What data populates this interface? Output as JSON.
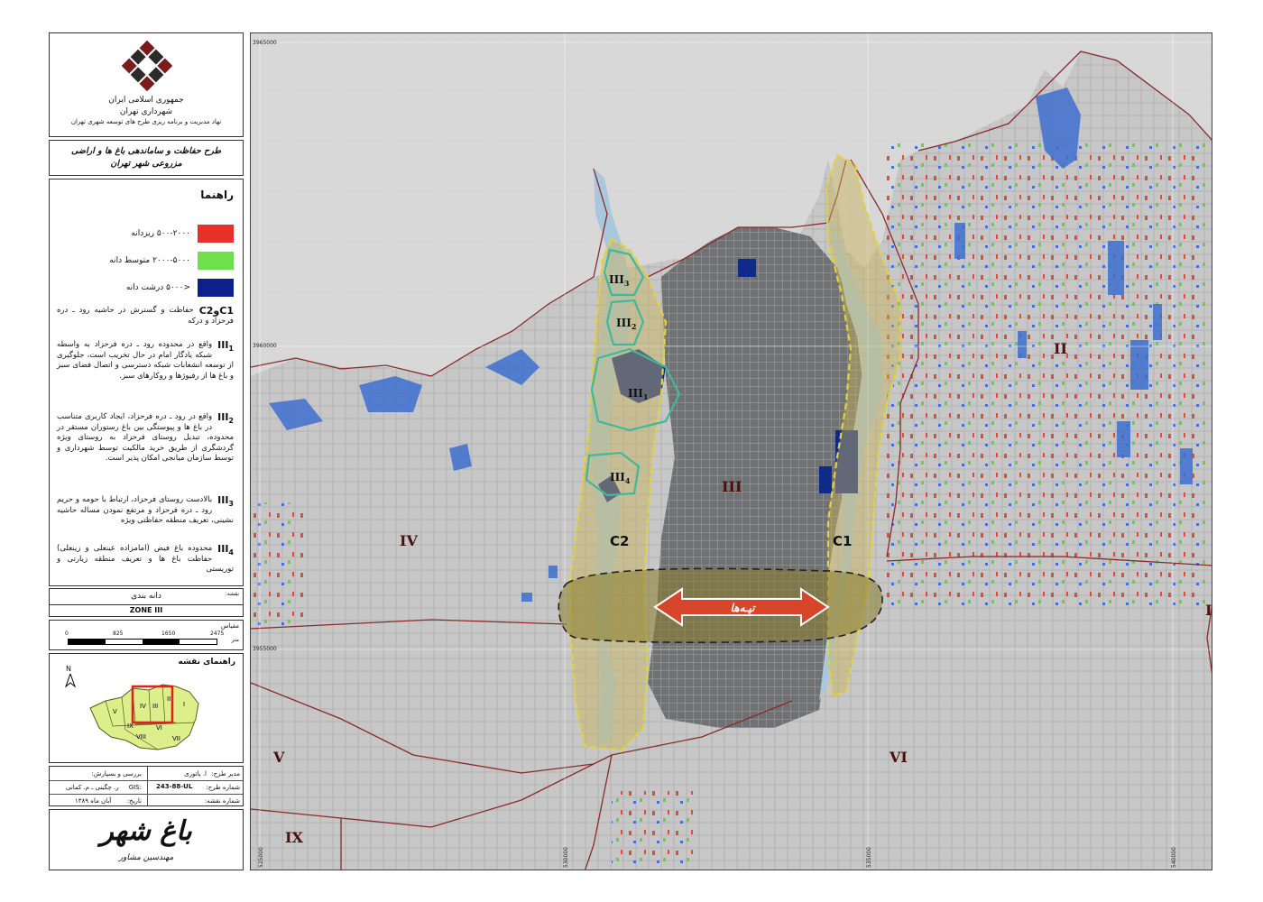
{
  "header": {
    "org_line1": "جمهوری اسلامی ایران",
    "org_line2": "شهرداری تهران",
    "org_line3": "نهاد مدیریت و برنامه ریزی طرح های توسعه شهری تهران"
  },
  "project_title": "طرح حفاظت و ساماندهی باغ ها و اراضی مزروعی شهر تهران",
  "legend": {
    "title": "راهنما",
    "items": [
      {
        "label": "۵۰۰-۲۰۰۰ ریزدانه",
        "color": "#e8302a"
      },
      {
        "label": "۲۰۰۰-۵۰۰۰ متوسط دانه",
        "color": "#6fe04a"
      },
      {
        "label": "<۵۰۰۰ درشت دانه",
        "color": "#0c1f8a"
      }
    ]
  },
  "descriptions": [
    {
      "code": "C1وC2",
      "text": "حفاظت و گسترش در حاشیه رود ـ دره فرحزاد و درکه"
    },
    {
      "code": "III",
      "sub": "1",
      "text": "واقع در محدوده رود ـ دره فرحزاد به واسطه شبکه یادگار امام در حال تخریب است، جلوگیری از توسعه انشعابات شبکه دسترسی و اتصال فضای سبز و باغ ها از رفیوژها و روکارهای سبز."
    },
    {
      "code": "III",
      "sub": "2",
      "text": "واقع در رود ـ دره فرحزاد، ایجاد کاربری متناسب در باغ ها و پیوستگی بین باغ رستوران مستقر در محدوده، تبدیل روستای فرحزاد به روستای ویژه گردشگری از طریق خرید مالکیت توسط شهرداری و توسط سازمان میانجی امکان پذیر است."
    },
    {
      "code": "III",
      "sub": "3",
      "text": "بالادست روستای فرحزاد، ارتباط با حومه و حریم رود ـ دره فرحزاد و مرتفع نمودن مساله حاشیه نشینی، تعریف منطقه حفاظتی ویژه"
    },
    {
      "code": "III",
      "sub": "4",
      "text": "محدوده باغ فیض (امامزاده عینعلی و زینعلی) حفاظت باغ ها و تعریف منطقه زیارتی و توریستی"
    }
  ],
  "map_info": {
    "caption_label": "نقشه:",
    "caption_value": "دانه بندی",
    "zone": "ZONE III"
  },
  "scale_bar": {
    "title": "مقیاس",
    "unit": "متر",
    "ticks": [
      "0",
      "825",
      "1650",
      "2475"
    ]
  },
  "guide_map": {
    "title": "راهنمای نقشه",
    "north": "N",
    "zones": [
      "I",
      "II",
      "III",
      "IV",
      "V",
      "VI",
      "VII",
      "VIII",
      "IX"
    ]
  },
  "info_table": {
    "row1_left_label": "بررسی و بسپارش:",
    "row1_right_label": "مدیر طرح:",
    "row1_right_value": "ا. پاتوری",
    "row2_left_label": "GIS:",
    "row2_left_value": "ر. چگینی ـ م. کمانی",
    "row2_right_label": "شماره طرح:",
    "row2_right_value": "243-88-UL",
    "row3_left_label": "تاریخ:",
    "row3_left_value": "آبان ماه ۱۳۸۹",
    "row3_right_label": "شماره نقشه:"
  },
  "footer": {
    "logo_text": "باغ شهر",
    "logo_sub": "مهندسین مشاور"
  },
  "map": {
    "zones": [
      "I",
      "II",
      "III",
      "IV",
      "V",
      "VI",
      "IX"
    ],
    "buffers": [
      "C1",
      "C2"
    ],
    "subzones": [
      {
        "main": "III",
        "sub": "1"
      },
      {
        "main": "III",
        "sub": "2"
      },
      {
        "main": "III",
        "sub": "3"
      },
      {
        "main": "III",
        "sub": "4"
      }
    ],
    "hills_label": "تپـه‌ها",
    "coords_top": [
      "3965000",
      "3960000",
      "3955000"
    ],
    "coords_bottom": [
      "525000",
      "530000",
      "535000",
      "540000"
    ]
  }
}
